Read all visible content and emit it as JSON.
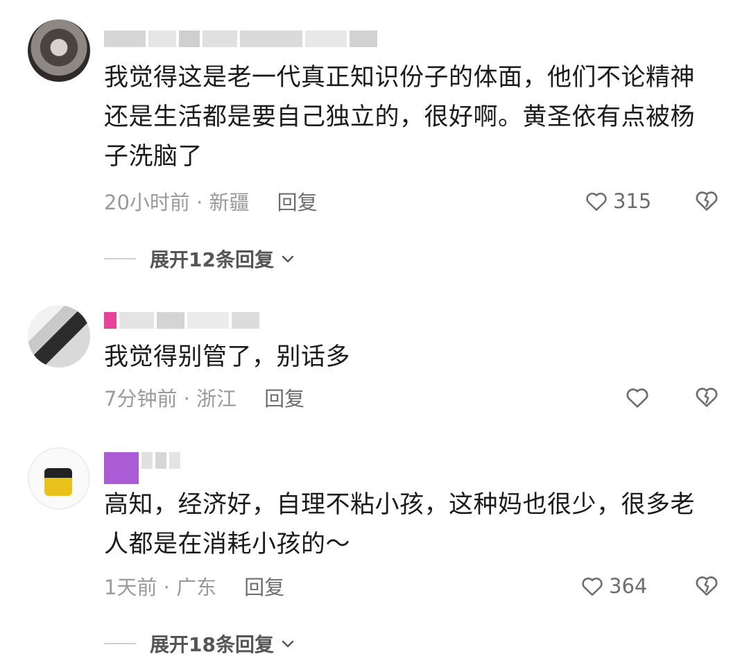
{
  "comments": [
    {
      "text": "我觉得这是老一代真正知识份子的体面，他们不论精神还是生活都是要自己独立的，很好啊。黄圣依有点被杨子洗脑了",
      "time_location": "20小时前 · 新疆",
      "reply_label": "回复",
      "likes": "315",
      "expand_label": "展开12条回复"
    },
    {
      "text": "我觉得别管了，别话多",
      "time_location": "7分钟前 · 浙江",
      "reply_label": "回复",
      "likes": ""
    },
    {
      "text": "高知，经济好，自理不粘小孩，这种妈也很少，很多老人都是在消耗小孩的～",
      "time_location": "1天前 · 广东",
      "reply_label": "回复",
      "likes": "364",
      "expand_label": "展开18条回复"
    }
  ],
  "colors": {
    "text": "#1b1b1b",
    "meta": "#9a9a9a",
    "icon": "#6d6d6d",
    "username_pink": "#e8439a",
    "username_purple": "#9b3fd0"
  },
  "icons": {
    "like": "heart-outline-icon",
    "dislike": "broken-heart-icon",
    "expand": "chevron-down-icon"
  }
}
